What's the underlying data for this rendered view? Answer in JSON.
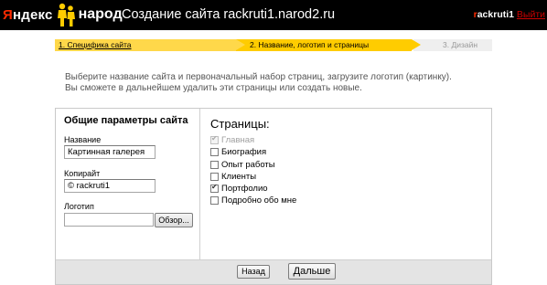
{
  "header": {
    "logo_yandex_first": "Я",
    "logo_yandex_rest": "ндекс",
    "logo_narod": "народ",
    "title": "Создание сайта rackruti1.narod2.ru",
    "user_first": "r",
    "user_rest": "ackruti1",
    "exit": "Выйти"
  },
  "steps": [
    {
      "label": "1. Специфика сайта",
      "state": "done"
    },
    {
      "label": "2. Название, логотип и страницы",
      "state": "current"
    },
    {
      "label": "3. Дизайн",
      "state": "upcoming"
    }
  ],
  "intro": {
    "line1": "Выберите название сайта и первоначальный набор страниц, загрузите логотип (картинку).",
    "line2": "Вы сможете в дальнейшем удалить эти страницы или создать новые."
  },
  "general": {
    "title": "Общие параметры сайта",
    "name_label": "Название",
    "name_value": "Картинная галерея",
    "copyright_label": "Копирайт",
    "copyright_value": "© rackruti1",
    "logo_label": "Логотип",
    "browse_label": "Обзор..."
  },
  "pages": {
    "title": "Страницы:",
    "items": [
      {
        "label": "Главная",
        "checked": true,
        "disabled": true
      },
      {
        "label": "Биография",
        "checked": false,
        "disabled": false
      },
      {
        "label": "Опыт работы",
        "checked": false,
        "disabled": false
      },
      {
        "label": "Клиенты",
        "checked": false,
        "disabled": false
      },
      {
        "label": "Портфолио",
        "checked": true,
        "disabled": false
      },
      {
        "label": "Подробно обо мне",
        "checked": false,
        "disabled": false
      }
    ]
  },
  "footer": {
    "back_label": "Назад",
    "next_label": "Дальше"
  },
  "colors": {
    "header_bg": "#000000",
    "step_active": "#ffcc00",
    "brand_red": "#ff2a00"
  }
}
